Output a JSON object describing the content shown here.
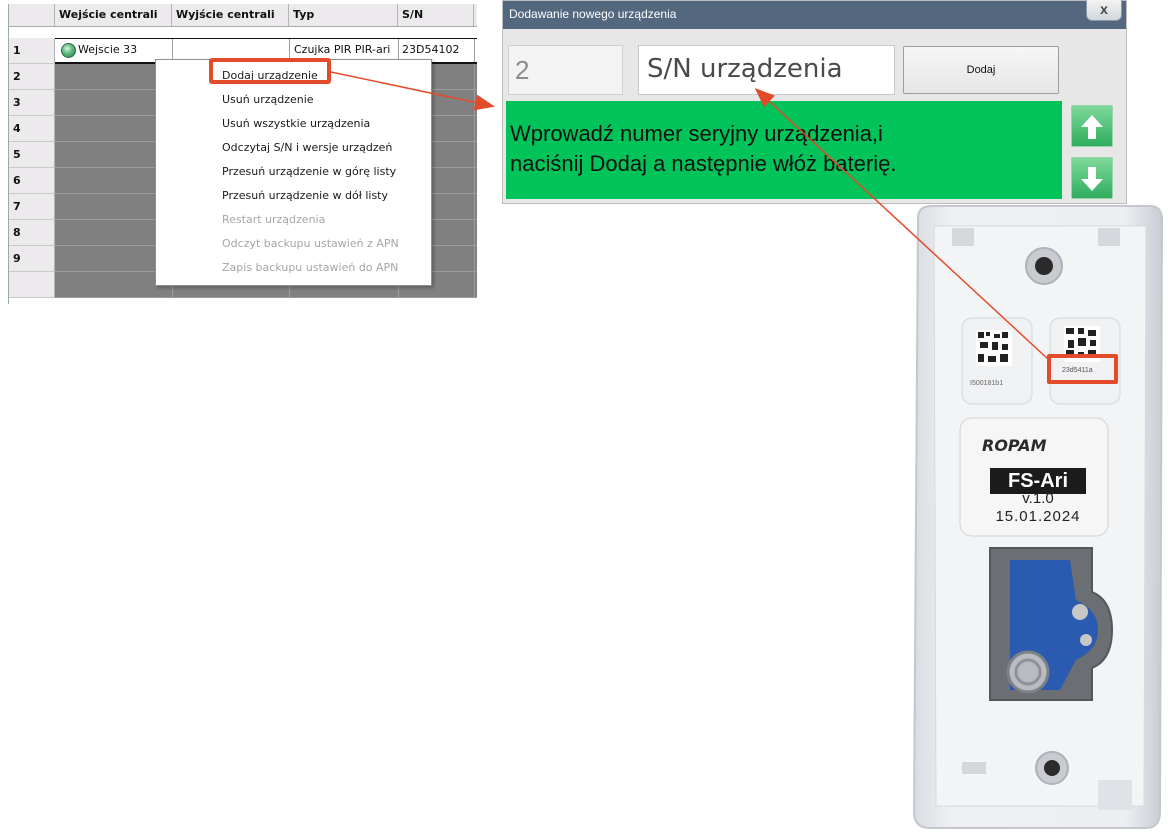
{
  "grid": {
    "headers": [
      "Wejście centrali",
      "Wyjście centrali",
      "Typ",
      "S/N",
      ""
    ],
    "row_numbers": [
      "1",
      "2",
      "3",
      "4",
      "5",
      "6",
      "7",
      "8",
      "9"
    ],
    "row1": {
      "input": "Wejscie 33",
      "output": "",
      "type": "Czujka PIR PIR-ari",
      "sn": "23D54102"
    }
  },
  "context_menu": {
    "items": [
      {
        "label": "Dodaj urządzenie",
        "enabled": true
      },
      {
        "label": "Usuń urządzenie",
        "enabled": true
      },
      {
        "label": "Usuń wszystkie urządzenia",
        "enabled": true
      },
      {
        "label": "Odczytaj S/N i wersje urządzeń",
        "enabled": true
      },
      {
        "label": "Przesuń urządzenie w górę listy",
        "enabled": true
      },
      {
        "label": "Przesuń urządzenie w dół listy",
        "enabled": true
      },
      {
        "label": "Restart urządzenia",
        "enabled": false
      },
      {
        "label": "Odczyt backupu ustawień z APN",
        "enabled": false
      },
      {
        "label": "Zapis backupu ustawień do APN",
        "enabled": false
      }
    ]
  },
  "dialog": {
    "title": "Dodawanie nowego urządzenia",
    "close_label": "x",
    "number": "2",
    "sn_placeholder": "S/N urządzenia",
    "add_label": "Dodaj",
    "message_line1": "Wprowadź numer seryjny urządzenia,i",
    "message_line2": "naciśnij Dodaj a następnie włóż baterię.",
    "message_color": "#00c35a"
  },
  "device": {
    "brand": "ROPAM",
    "model": "FS-Ari",
    "version": "v.1.0",
    "date": "15.01.2024",
    "sn_label": "23d5411a",
    "sn_label2": "I500181b1"
  },
  "colors": {
    "highlight": "#e34c2a",
    "title_bar": "#53677f"
  }
}
